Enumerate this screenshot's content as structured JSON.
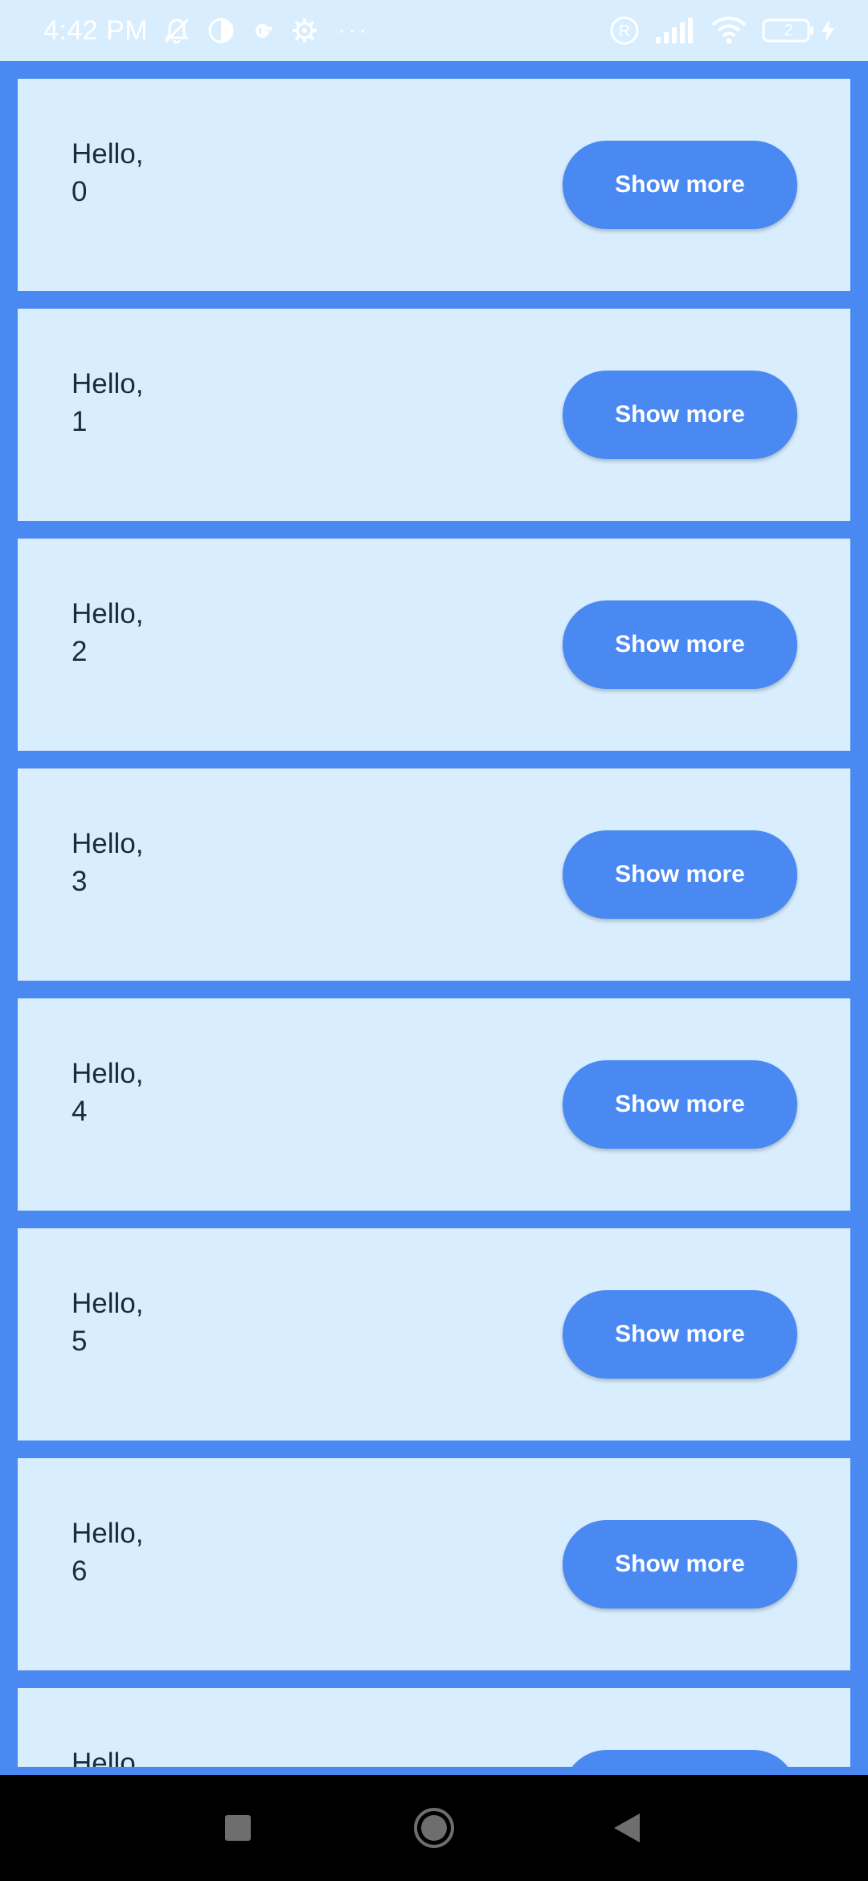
{
  "status_bar": {
    "time": "4:42 PM",
    "left_icons": [
      "muted-bell-icon",
      "data-saver-icon",
      "google-icon",
      "settings-icon"
    ],
    "overflow": "···",
    "right_icons": [
      "registered-icon",
      "signal-icon",
      "wifi-icon",
      "battery-icon",
      "charging-icon"
    ],
    "battery_level": "2"
  },
  "cards": [
    {
      "greeting": "Hello,",
      "index": "0",
      "button_label": "Show more"
    },
    {
      "greeting": "Hello,",
      "index": "1",
      "button_label": "Show more"
    },
    {
      "greeting": "Hello,",
      "index": "2",
      "button_label": "Show more"
    },
    {
      "greeting": "Hello,",
      "index": "3",
      "button_label": "Show more"
    },
    {
      "greeting": "Hello,",
      "index": "4",
      "button_label": "Show more"
    },
    {
      "greeting": "Hello,",
      "index": "5",
      "button_label": "Show more"
    },
    {
      "greeting": "Hello,",
      "index": "6",
      "button_label": "Show more"
    },
    {
      "greeting": "Hello,",
      "index": "",
      "button_label": ""
    }
  ],
  "nav_bar": {
    "buttons": [
      "recents-square-icon",
      "home-circle-icon",
      "back-triangle-icon"
    ]
  },
  "colors": {
    "accent": "#4a88f2",
    "card_background": "#d8eefe",
    "text": "#1a2b3a",
    "nav_background": "#000000"
  }
}
